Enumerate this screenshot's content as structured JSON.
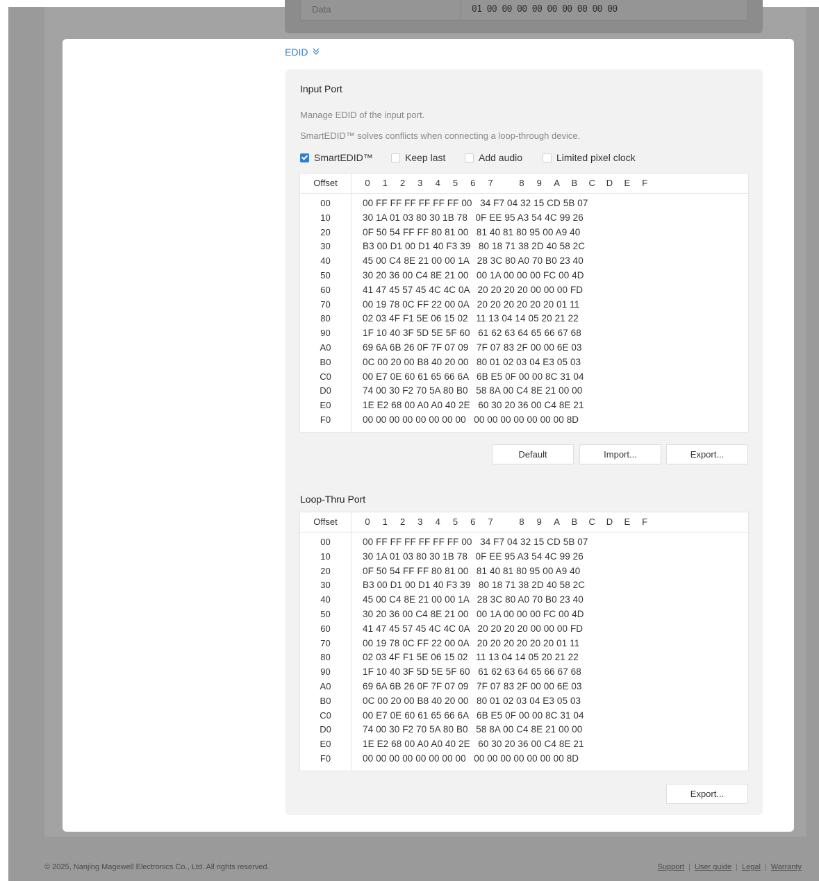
{
  "background_row": {
    "label": "Data",
    "value": "01 00 00 00 00 00 00 00 00 00"
  },
  "edid_toggle": {
    "label": "EDID",
    "chevron": "≫"
  },
  "input_port": {
    "title": "Input Port",
    "desc1": "Manage EDID of the input port.",
    "desc2": "SmartEDID™ solves conflicts when connecting a loop-through device.",
    "checkboxes": [
      {
        "label": "SmartEDID™",
        "checked": true
      },
      {
        "label": "Keep last",
        "checked": false
      },
      {
        "label": "Add audio",
        "checked": false
      },
      {
        "label": "Limited pixel clock",
        "checked": false
      }
    ],
    "buttons": {
      "default": "Default",
      "import": "Import...",
      "export": "Export..."
    }
  },
  "loop_thru_port": {
    "title": "Loop-Thru Port",
    "buttons": {
      "export": "Export..."
    }
  },
  "hex_table": {
    "offset_header": "Offset",
    "col_headers": [
      "0",
      "1",
      "2",
      "3",
      "4",
      "5",
      "6",
      "7",
      "8",
      "9",
      "A",
      "B",
      "C",
      "D",
      "E",
      "F"
    ],
    "rows": [
      {
        "offset": "00",
        "data": "00 FF FF FF FF FF FF 00   34 F7 04 32 15 CD 5B 07"
      },
      {
        "offset": "10",
        "data": "30 1A 01 03 80 30 1B 78   0F EE 95 A3 54 4C 99 26"
      },
      {
        "offset": "20",
        "data": "0F 50 54 FF FF 80 81 00   81 40 81 80 95 00 A9 40"
      },
      {
        "offset": "30",
        "data": "B3 00 D1 00 D1 40 F3 39   80 18 71 38 2D 40 58 2C"
      },
      {
        "offset": "40",
        "data": "45 00 C4 8E 21 00 00 1A   28 3C 80 A0 70 B0 23 40"
      },
      {
        "offset": "50",
        "data": "30 20 36 00 C4 8E 21 00   00 1A 00 00 00 FC 00 4D"
      },
      {
        "offset": "60",
        "data": "41 47 45 57 45 4C 4C 0A   20 20 20 20 00 00 00 FD"
      },
      {
        "offset": "70",
        "data": "00 19 78 0C FF 22 00 0A   20 20 20 20 20 20 01 11"
      },
      {
        "offset": "80",
        "data": "02 03 4F F1 5E 06 15 02   11 13 04 14 05 20 21 22"
      },
      {
        "offset": "90",
        "data": "1F 10 40 3F 5D 5E 5F 60   61 62 63 64 65 66 67 68"
      },
      {
        "offset": "A0",
        "data": "69 6A 6B 26 0F 7F 07 09   7F 07 83 2F 00 00 6E 03"
      },
      {
        "offset": "B0",
        "data": "0C 00 20 00 B8 40 20 00   80 01 02 03 04 E3 05 03"
      },
      {
        "offset": "C0",
        "data": "00 E7 0E 60 61 65 66 6A   6B E5 0F 00 00 8C 31 04"
      },
      {
        "offset": "D0",
        "data": "74 00 30 F2 70 5A 80 B0   58 8A 00 C4 8E 21 00 00"
      },
      {
        "offset": "E0",
        "data": "1E E2 68 00 A0 A0 40 2E   60 30 20 36 00 C4 8E 21"
      },
      {
        "offset": "F0",
        "data": "00 00 00 00 00 00 00 00   00 00 00 00 00 00 00 8D"
      }
    ]
  },
  "footer": {
    "copyright": "© 2025, Nanjing Magewell Electronics Co., Ltd. All rights reserved.",
    "links": [
      "Support",
      "User guide",
      "Legal",
      "Warranty"
    ]
  }
}
